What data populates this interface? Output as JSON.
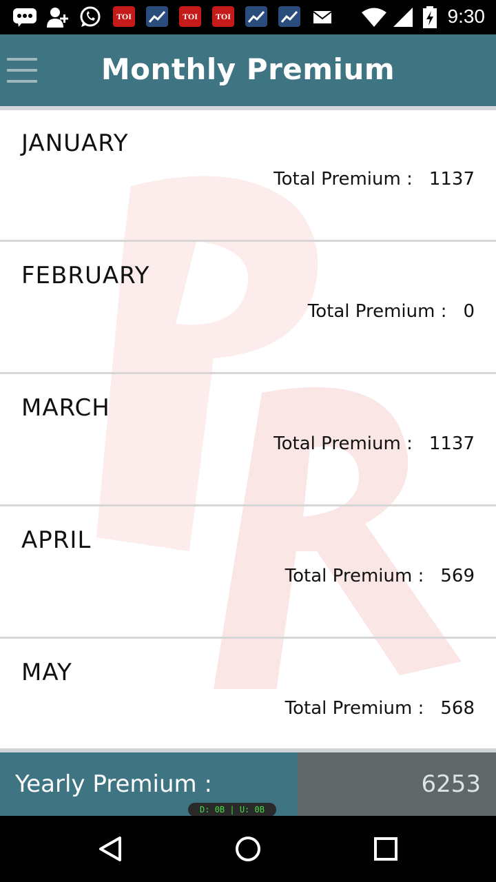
{
  "status_bar": {
    "time": "9:30",
    "toi_label": "TOI",
    "icons": [
      "bbm-icon",
      "add-contact-icon",
      "whatsapp-icon",
      "toi-icon",
      "stock-chart-icon",
      "toi-icon",
      "toi-icon",
      "stock-chart-icon",
      "stock-chart-icon",
      "mail-icon",
      "wifi-icon",
      "signal-icon",
      "battery-charging-icon"
    ]
  },
  "app_bar": {
    "title": "Monthly Premium",
    "color": "#3f7482"
  },
  "months": [
    {
      "name": "JANUARY",
      "premium_label": "Total Premium :",
      "premium_value": "1137"
    },
    {
      "name": "FEBRUARY",
      "premium_label": "Total Premium :",
      "premium_value": "0"
    },
    {
      "name": "MARCH",
      "premium_label": "Total Premium :",
      "premium_value": "1137"
    },
    {
      "name": "APRIL",
      "premium_label": "Total Premium :",
      "premium_value": "569"
    },
    {
      "name": "MAY",
      "premium_label": "Total Premium :",
      "premium_value": "568"
    }
  ],
  "footer": {
    "yearly_label": "Yearly Premium :",
    "yearly_value": "6253",
    "data_usage": "D: 0B | U: 0B"
  },
  "nav_bar": {
    "icons": [
      "back-icon",
      "home-icon",
      "recents-icon"
    ]
  }
}
